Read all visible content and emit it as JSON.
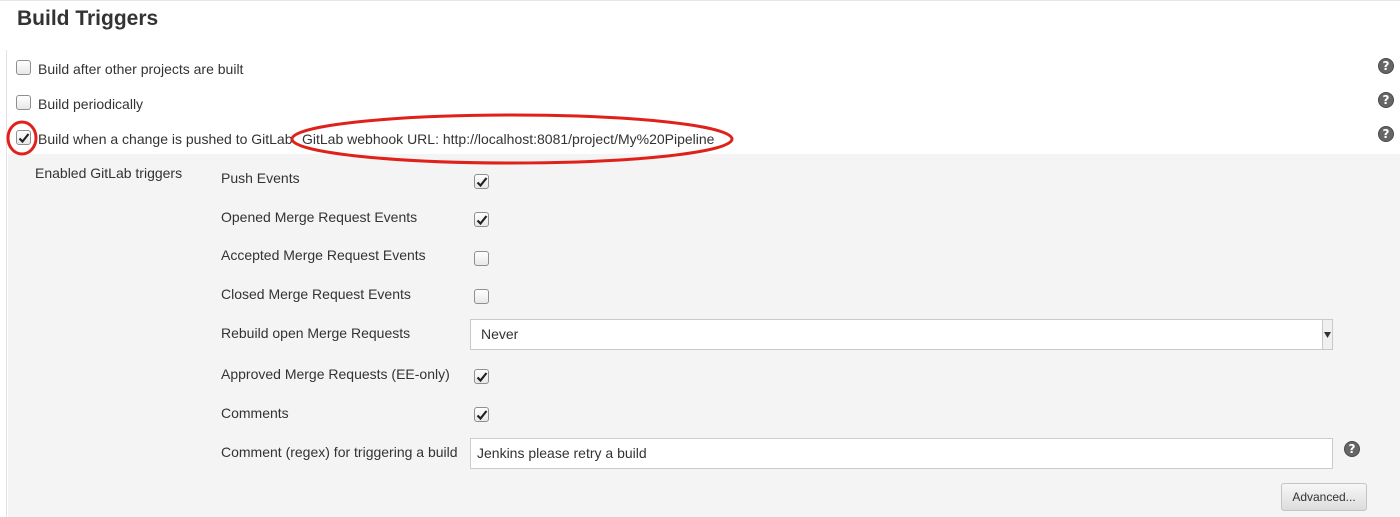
{
  "section": {
    "title": "Build Triggers"
  },
  "triggers": [
    {
      "label": "Build after other projects are built",
      "checked": false
    },
    {
      "label": "Build periodically",
      "checked": false
    },
    {
      "label": "Build when a change is pushed to GitLab.",
      "checked": true
    }
  ],
  "gitlab": {
    "webhook_text": "GitLab webhook URL: http://localhost:8081/project/My%20Pipeline",
    "enabled_triggers_label": "Enabled GitLab triggers",
    "options": [
      {
        "label": "Push Events",
        "checked": true
      },
      {
        "label": "Opened Merge Request Events",
        "checked": true
      },
      {
        "label": "Accepted Merge Request Events",
        "checked": false
      },
      {
        "label": "Closed Merge Request Events",
        "checked": false
      }
    ],
    "rebuild": {
      "label": "Rebuild open Merge Requests",
      "value": "Never"
    },
    "options2": [
      {
        "label": "Approved Merge Requests (EE-only)",
        "checked": true
      },
      {
        "label": "Comments",
        "checked": true
      }
    ],
    "comment_regex": {
      "label": "Comment (regex) for triggering a build",
      "value": "Jenkins please retry a build"
    },
    "advanced_label": "Advanced..."
  },
  "help_icon": "question-mark-icon",
  "colors": {
    "annotation": "#e0201a",
    "panel": "#f4f4f4",
    "help": "#666666"
  }
}
